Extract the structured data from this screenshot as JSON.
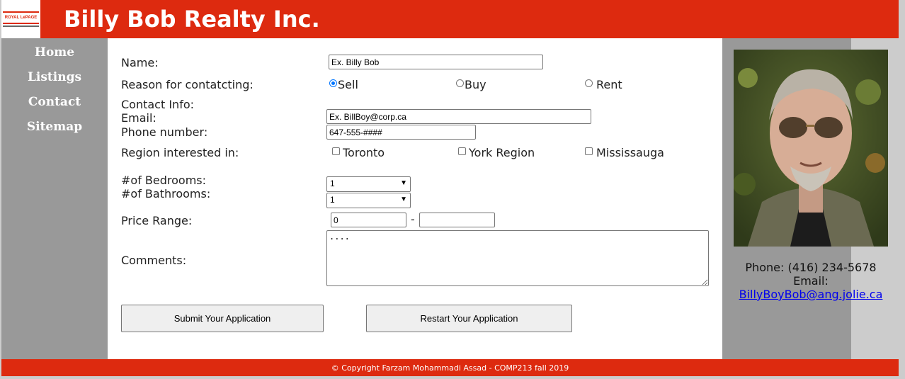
{
  "header": {
    "title": "Billy Bob Realty Inc.",
    "logo_text": "ROYAL LePAGE"
  },
  "nav": {
    "items": [
      "Home",
      "Listings",
      "Contact",
      "Sitemap"
    ]
  },
  "form": {
    "name_label": "Name:",
    "name_value": "Ex. Billy Bob",
    "reason_label": "Reason for contatcting:",
    "reasons": [
      "Sell",
      "Buy",
      "Rent"
    ],
    "reason_selected": "Sell",
    "contact_info_label": "Contact Info:",
    "email_label": "Email:",
    "email_value": "Ex. BillBoy@corp.ca",
    "phone_label": "Phone number:",
    "phone_value": "647-555-####",
    "region_label": "Region interested in:",
    "regions": [
      "Toronto",
      "York Region",
      "Mississauga"
    ],
    "bedrooms_label": "#of Bedrooms:",
    "bedrooms_value": "1",
    "bathrooms_label": "#of Bathrooms:",
    "bathrooms_value": "1",
    "price_label": "Price Range:",
    "price_min": "0",
    "price_max": "",
    "price_sep": "-",
    "comments_label": "Comments:",
    "comments_value": "....",
    "submit_label": "Submit Your Application",
    "restart_label": "Restart Your Application"
  },
  "agent": {
    "phone": "Phone: (416) 234-5678",
    "email_label": "Email:",
    "email": "BillyBoyBob@ang.jolie.ca"
  },
  "footer": {
    "text": "© Copyright Farzam Mohammadi Assad - COMP213 fall 2019"
  },
  "colors": {
    "brand_red": "#dd2a0f",
    "nav_gray": "#999999",
    "page_gray": "#cccccc"
  }
}
